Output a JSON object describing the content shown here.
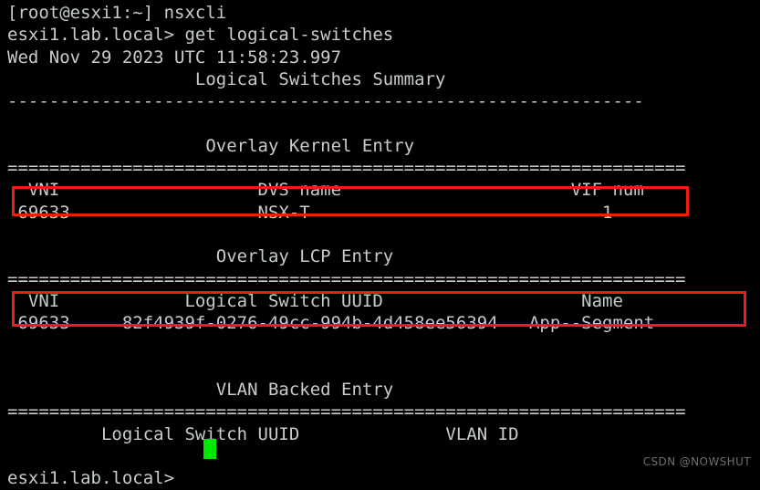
{
  "terminal": {
    "background_color": "#000000",
    "text_color": "#c6cbce",
    "cursor_color": "#00e800",
    "highlight_color": "#f01c10",
    "prompt_host": "esxi1.lab.local>",
    "shell_prompt": "[root@esxi1:~]",
    "command_entered": "nsxcli",
    "lines": {
      "l01_shell_prompt": "[root@esxi1:~] nsxcli",
      "l02_command": "esxi1.lab.local> get logical-switches",
      "l03_timestamp": "Wed Nov 29 2023 UTC 11:58:23.997",
      "l04_title": "                  Logical Switches Summary",
      "l05_dash_rule": "-------------------------------------------------------------",
      "l06_blank": "",
      "l07_section_kernel": "                   Overlay Kernel Entry",
      "l08_eq_rule": "=================================================================",
      "l09_kernel_headers": "  VNI                   DVS name                      VIF num",
      "l10_kernel_row": " 69633                  NSX-T                            1",
      "l11_blank": "",
      "l12_section_lcp": "                    Overlay LCP Entry",
      "l13_eq_rule": "=================================================================",
      "l14_lcp_headers": "  VNI            Logical Switch UUID                   Name",
      "l15_lcp_row": " 69633     82f4939f-0276-49cc-994b-4d458ee56394   App--Segment",
      "l16_blank": "",
      "l17_blank": "",
      "l18_section_vlan": "                    VLAN Backed Entry",
      "l19_eq_rule": "=================================================================",
      "l20_vlan_headers": "         Logical Switch UUID              VLAN ID",
      "l21_blank": "",
      "l22_prompt": "esxi1.lab.local>"
    }
  },
  "sections": {
    "summary_title": "Logical Switches Summary",
    "overlay_kernel": {
      "title": "Overlay Kernel Entry",
      "columns": [
        "VNI",
        "DVS name",
        "VIF num"
      ],
      "rows": [
        {
          "vni": "69633",
          "dvs_name": "NSX-T",
          "vif_num": "1"
        }
      ]
    },
    "overlay_lcp": {
      "title": "Overlay LCP Entry",
      "columns": [
        "VNI",
        "Logical Switch UUID",
        "Name"
      ],
      "rows": [
        {
          "vni": "69633",
          "uuid": "82f4939f-0276-49cc-994b-4d458ee56394",
          "name": "App--Segment"
        }
      ]
    },
    "vlan_backed": {
      "title": "VLAN Backed Entry",
      "columns": [
        "Logical Switch UUID",
        "VLAN ID"
      ],
      "rows": []
    }
  },
  "timestamp": {
    "weekday": "Wed",
    "month": "Nov",
    "day": "29",
    "year": "2023",
    "zone": "UTC",
    "time": "11:58:23.997"
  },
  "annotations": {
    "kernel_row_highlight_label": "Overlay Kernel Entry row highlight",
    "lcp_row_highlight_label": "Overlay LCP Entry row highlight"
  },
  "watermark": {
    "text": "CSDN @NOWSHUT"
  }
}
